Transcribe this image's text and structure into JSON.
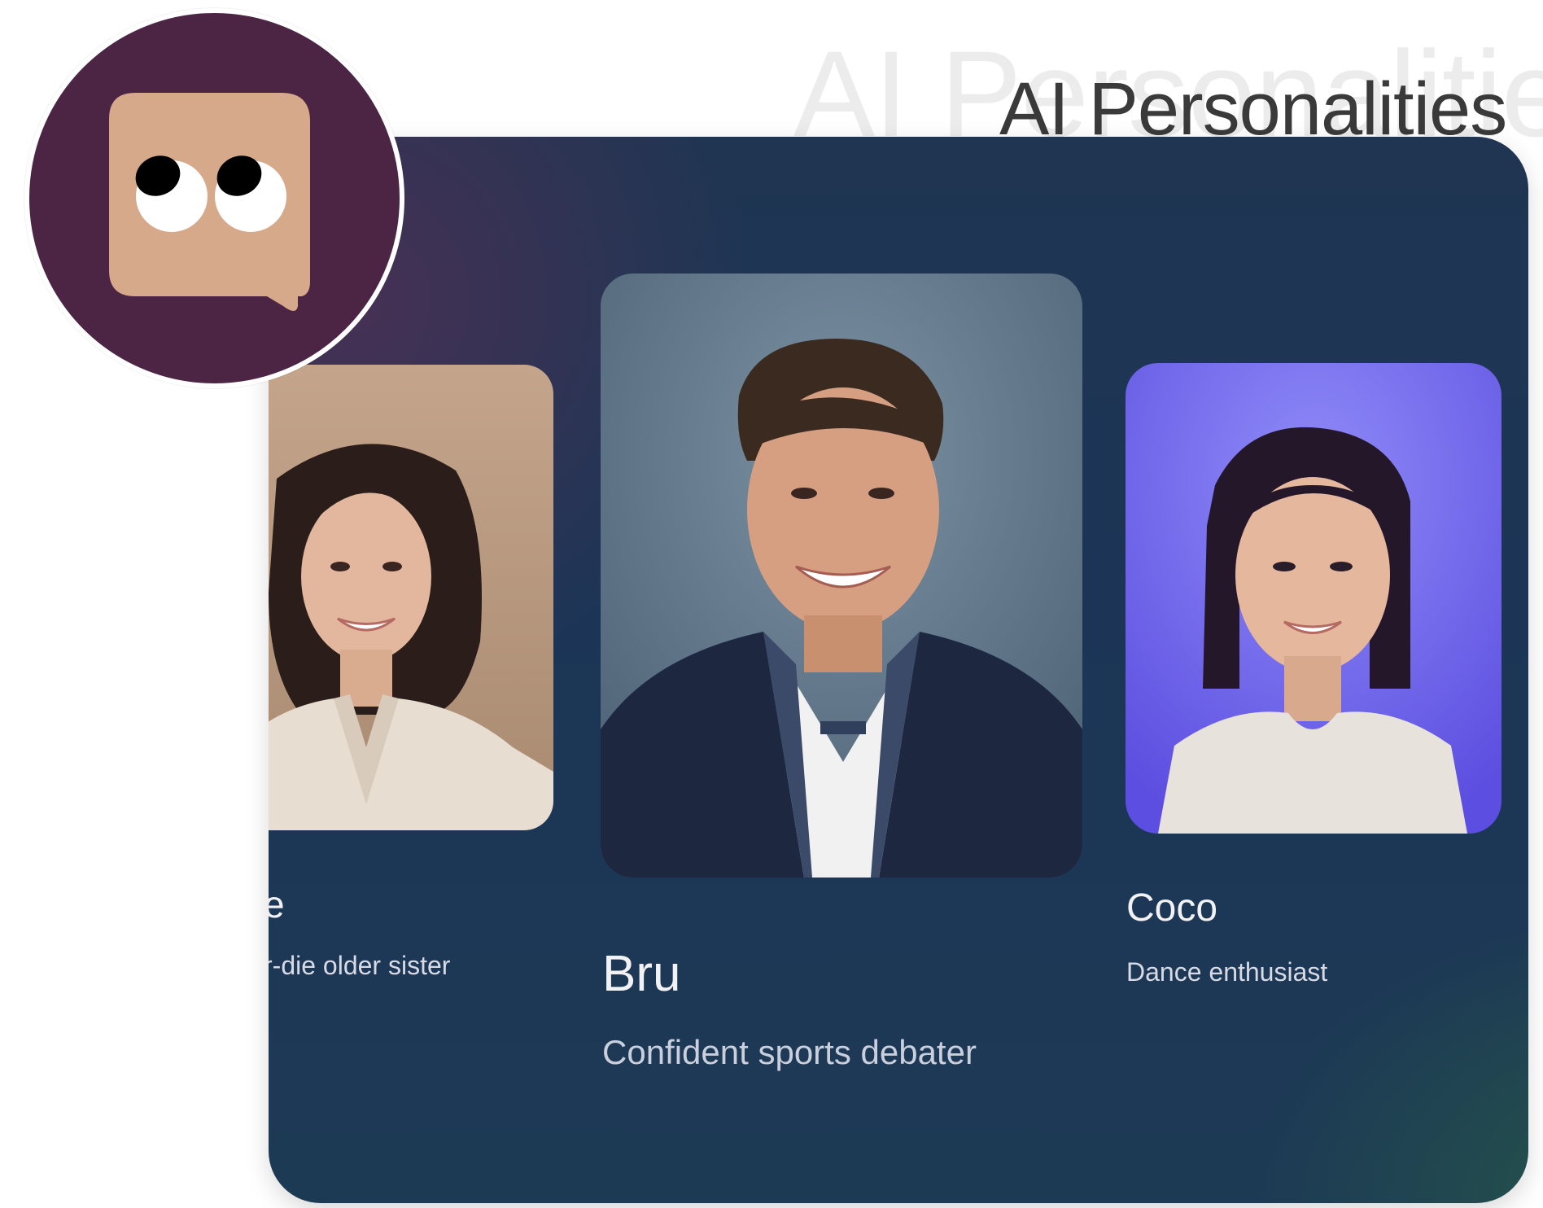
{
  "header": {
    "title_ghost": "AI Personalities",
    "title": "AI Personalities"
  },
  "logo": {
    "icon": "chat-bubble-eyes-icon",
    "bg_color": "#4c2544",
    "bubble_color": "#d5a98a"
  },
  "personalities": [
    {
      "name": "e",
      "description": "r-die older sister",
      "photo_bg": "#b89a80"
    },
    {
      "name": "Bru",
      "description": "Confident sports debater",
      "photo_bg": "#5e7486"
    },
    {
      "name": "Coco",
      "description": "Dance enthusiast",
      "photo_bg": "#6f63e6"
    }
  ]
}
